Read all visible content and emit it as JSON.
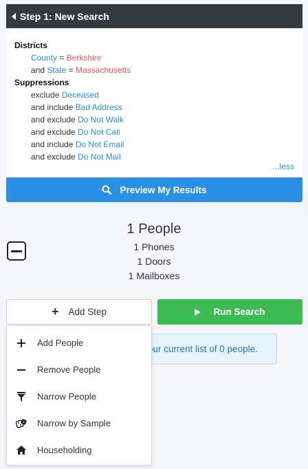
{
  "step_card": {
    "title": "Step 1: New Search",
    "districts_title": "Districts",
    "districts": [
      {
        "field": "County",
        "op": "=",
        "value": "Berkshire",
        "prefix": ""
      },
      {
        "field": "State",
        "op": "=",
        "value": "Massachusetts",
        "prefix": "and"
      }
    ],
    "suppressions_title": "Suppressions",
    "suppressions": [
      {
        "action": "exclude",
        "name": "Deceased"
      },
      {
        "action": "and include",
        "name": "Bad Address"
      },
      {
        "action": "and exclude",
        "name": "Do Not Walk"
      },
      {
        "action": "and exclude",
        "name": "Do Not Call"
      },
      {
        "action": "and include",
        "name": "Do Not Email"
      },
      {
        "action": "and exclude",
        "name": "Do Not Mail"
      }
    ],
    "less_link": "...less",
    "preview_button": "Preview My Results"
  },
  "results": {
    "people": "1 People",
    "phones": "1 Phones",
    "doors": "1 Doors",
    "mailboxes": "1 Mailboxes"
  },
  "actions": {
    "add_step": "Add Step",
    "run_search": "Run Search",
    "info_text": "our current list of 0 people."
  },
  "add_step_menu": [
    {
      "label": "Add People",
      "icon": "plus-icon"
    },
    {
      "label": "Remove People",
      "icon": "minus-icon"
    },
    {
      "label": "Narrow People",
      "icon": "filter-icon"
    },
    {
      "label": "Narrow by Sample",
      "icon": "dice-icon"
    },
    {
      "label": "Householding",
      "icon": "home-icon"
    }
  ],
  "colors": {
    "header_bg": "#343a40",
    "link_blue": "#2a8bd8",
    "value_red": "#e05454",
    "preview_blue": "#2b8fe4",
    "run_green": "#3cba54"
  }
}
